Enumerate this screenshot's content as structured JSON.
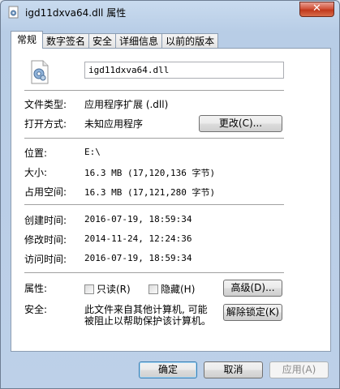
{
  "window": {
    "title": "igd11dxva64.dll 属性",
    "close_glyph": "✕"
  },
  "tabs": [
    {
      "label": "常规"
    },
    {
      "label": "数字签名"
    },
    {
      "label": "安全"
    },
    {
      "label": "详细信息"
    },
    {
      "label": "以前的版本"
    }
  ],
  "general": {
    "filename": "igd11dxva64.dll",
    "file_type_label": "文件类型:",
    "file_type_value": "应用程序扩展 (.dll)",
    "opens_with_label": "打开方式:",
    "opens_with_value": "未知应用程序",
    "change_button": "更改(C)...",
    "location_label": "位置:",
    "location_value": "E:\\",
    "size_label": "大小:",
    "size_value": "16.3 MB (17,120,136 字节)",
    "size_on_disk_label": "占用空间:",
    "size_on_disk_value": "16.3 MB (17,121,280 字节)",
    "created_label": "创建时间:",
    "created_value": "2016-07-19, 18:59:34",
    "modified_label": "修改时间:",
    "modified_value": "2014-11-24, 12:24:36",
    "accessed_label": "访问时间:",
    "accessed_value": "2016-07-19, 18:59:34",
    "attributes_label": "属性:",
    "readonly_label": "只读(R)",
    "hidden_label": "隐藏(H)",
    "advanced_button": "高级(D)...",
    "security_label": "安全:",
    "security_text_line1": "此文件来自其他计算机, 可能",
    "security_text_line2": "被阻止以帮助保护该计算机。",
    "unblock_button": "解除锁定(K)"
  },
  "footer": {
    "ok_button": "确定",
    "cancel_button": "取消",
    "apply_button": "应用(A)"
  },
  "colors": {
    "window_frame": "#bdd0e8",
    "close_button": "#c0391c",
    "panel": "#ffffff"
  }
}
